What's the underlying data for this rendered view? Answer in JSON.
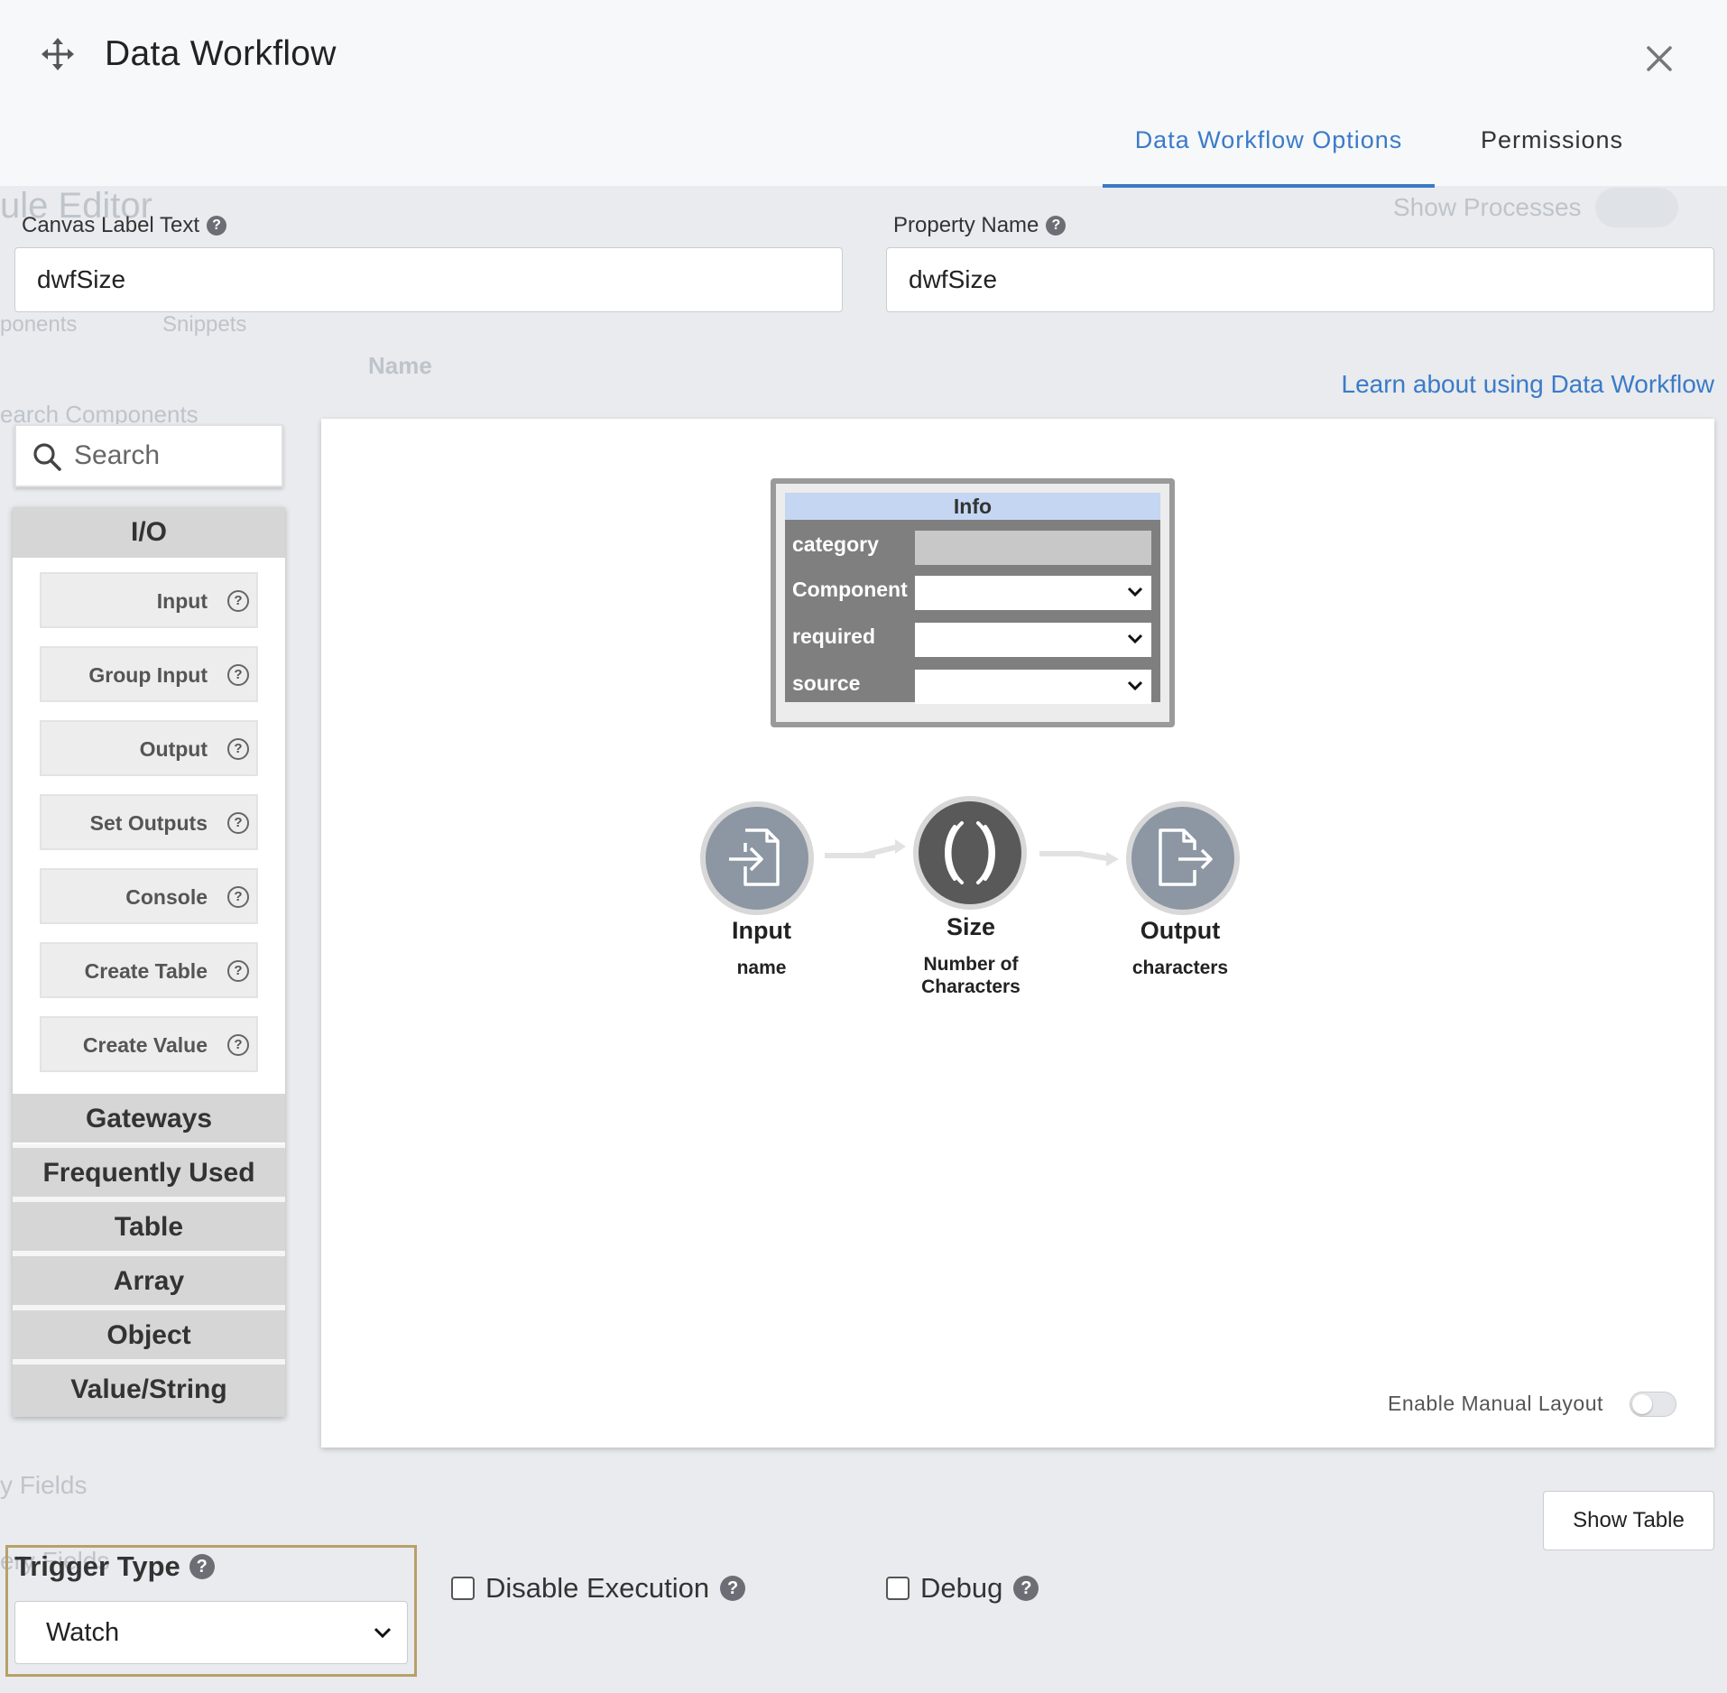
{
  "background": {
    "ghost_texts": {
      "rule_editor": "ule Editor",
      "show_processes": "Show Processes",
      "components_tab": "ponents",
      "snippets_tab": "Snippets",
      "name_header": "Name",
      "search_components": "earch Components",
      "fields_1": "y Fields",
      "fields_2": "ery Fields"
    }
  },
  "header": {
    "title": "Data Workflow",
    "tabs": [
      {
        "label": "Data Workflow Options",
        "active": true
      },
      {
        "label": "Permissions",
        "active": false
      }
    ]
  },
  "form": {
    "canvas_label": {
      "label": "Canvas Label Text",
      "value": "dwfSize"
    },
    "property_name": {
      "label": "Property Name",
      "value": "dwfSize"
    },
    "learn_link": "Learn about using Data Workflow"
  },
  "sidebar": {
    "search_placeholder": "Search",
    "categories": [
      "I/O",
      "Gateways",
      "Frequently Used",
      "Table",
      "Array",
      "Object",
      "Value/String"
    ],
    "io_items": [
      "Input",
      "Group Input",
      "Output",
      "Set Outputs",
      "Console",
      "Create Table",
      "Create Value"
    ]
  },
  "canvas": {
    "info_panel": {
      "title": "Info",
      "rows": [
        "category",
        "Component",
        "required",
        "source"
      ]
    },
    "nodes": [
      {
        "title": "Input",
        "subtitle": "name",
        "icon": "file-import-icon"
      },
      {
        "title": "Size",
        "subtitle": "Number of Characters",
        "icon": "parentheses-icon"
      },
      {
        "title": "Output",
        "subtitle": "characters",
        "icon": "file-export-icon"
      }
    ],
    "manual_layout_label": "Enable Manual Layout",
    "manual_layout_enabled": false
  },
  "actions": {
    "show_table": "Show Table"
  },
  "options": {
    "trigger_type": {
      "label": "Trigger Type",
      "value": "Watch"
    },
    "disable_execution": {
      "label": "Disable Execution",
      "checked": false
    },
    "debug": {
      "label": "Debug",
      "checked": false
    }
  },
  "colors": {
    "accent": "#3a7bc8",
    "node_input": "#8c97a3",
    "node_size": "#595959",
    "node_output": "#8c97a3",
    "info_header": "#c4d6f2",
    "trigger_frame": "#b8a06a"
  }
}
